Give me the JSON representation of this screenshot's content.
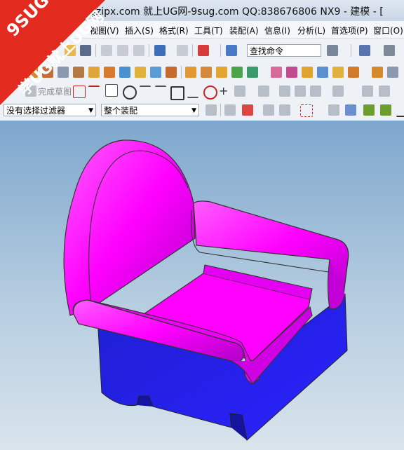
{
  "titlebar": {
    "title": "gzipx.com 就上UG网-9sug.com QQ:838676806 NX9 - 建模 - ["
  },
  "watermark": {
    "line1": "9SUG",
    "line2": "学UG就上UG网"
  },
  "menu": [
    "视图(V)",
    "插入(S)",
    "格式(R)",
    "工具(T)",
    "装配(A)",
    "信息(I)",
    "分析(L)",
    "首选项(P)",
    "窗口(O)"
  ],
  "toolbar": {
    "search_placeholder": "查找命令",
    "finish_sketch": "完成草图"
  },
  "filters": {
    "selection_filter": "没有选择过滤器",
    "assembly_scope": "整个装配"
  },
  "colors": {
    "sofa_top": "#ff00ff",
    "sofa_base": "#2420e0",
    "accent": "#e32a1f"
  }
}
